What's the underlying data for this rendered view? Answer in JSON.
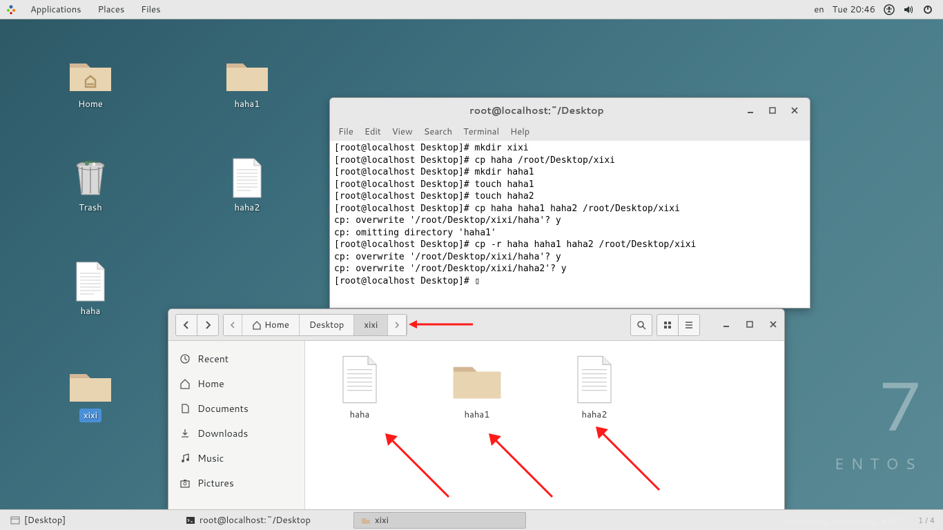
{
  "top_panel": {
    "applications": "Applications",
    "places": "Places",
    "files": "Files",
    "lang": "en",
    "datetime": "Tue 20:46"
  },
  "desktop_icons": {
    "home": "Home",
    "trash": "Trash",
    "haha": "haha",
    "haha1": "haha1",
    "haha2": "haha2",
    "xixi": "xixi"
  },
  "terminal": {
    "title": "root@localhost:~/Desktop",
    "menu": {
      "file": "File",
      "edit": "Edit",
      "view": "View",
      "search": "Search",
      "terminal": "Terminal",
      "help": "Help"
    },
    "lines": "[root@localhost Desktop]# mkdir xixi\n[root@localhost Desktop]# cp haha /root/Desktop/xixi\n[root@localhost Desktop]# mkdir haha1\n[root@localhost Desktop]# touch haha1\n[root@localhost Desktop]# touch haha2\n[root@localhost Desktop]# cp haha haha1 haha2 /root/Desktop/xixi\ncp: overwrite '/root/Desktop/xixi/haha'? y\ncp: omitting directory 'haha1'\n[root@localhost Desktop]# cp -r haha haha1 haha2 /root/Desktop/xixi\ncp: overwrite '/root/Desktop/xixi/haha'? y\ncp: overwrite '/root/Desktop/xixi/haha2'? y\n[root@localhost Desktop]# ▯"
  },
  "files_window": {
    "breadcrumb": {
      "home": "Home",
      "desktop": "Desktop",
      "xixi": "xixi"
    },
    "sidebar": {
      "recent": "Recent",
      "home": "Home",
      "documents": "Documents",
      "downloads": "Downloads",
      "music": "Music",
      "pictures": "Pictures"
    },
    "files": {
      "haha": "haha",
      "haha1": "haha1",
      "haha2": "haha2"
    }
  },
  "taskbar": {
    "desktop": "[Desktop]",
    "terminal": "root@localhost:~/Desktop",
    "xixi": "xixi",
    "pager": "1 / 4"
  },
  "centos": {
    "number": "7",
    "text": "ENTOS"
  },
  "watermark": "https://blog.csdn.net/qq_4357...",
  "colors": {
    "accent": "#4a90d9",
    "panel": "#e8e8e8"
  }
}
